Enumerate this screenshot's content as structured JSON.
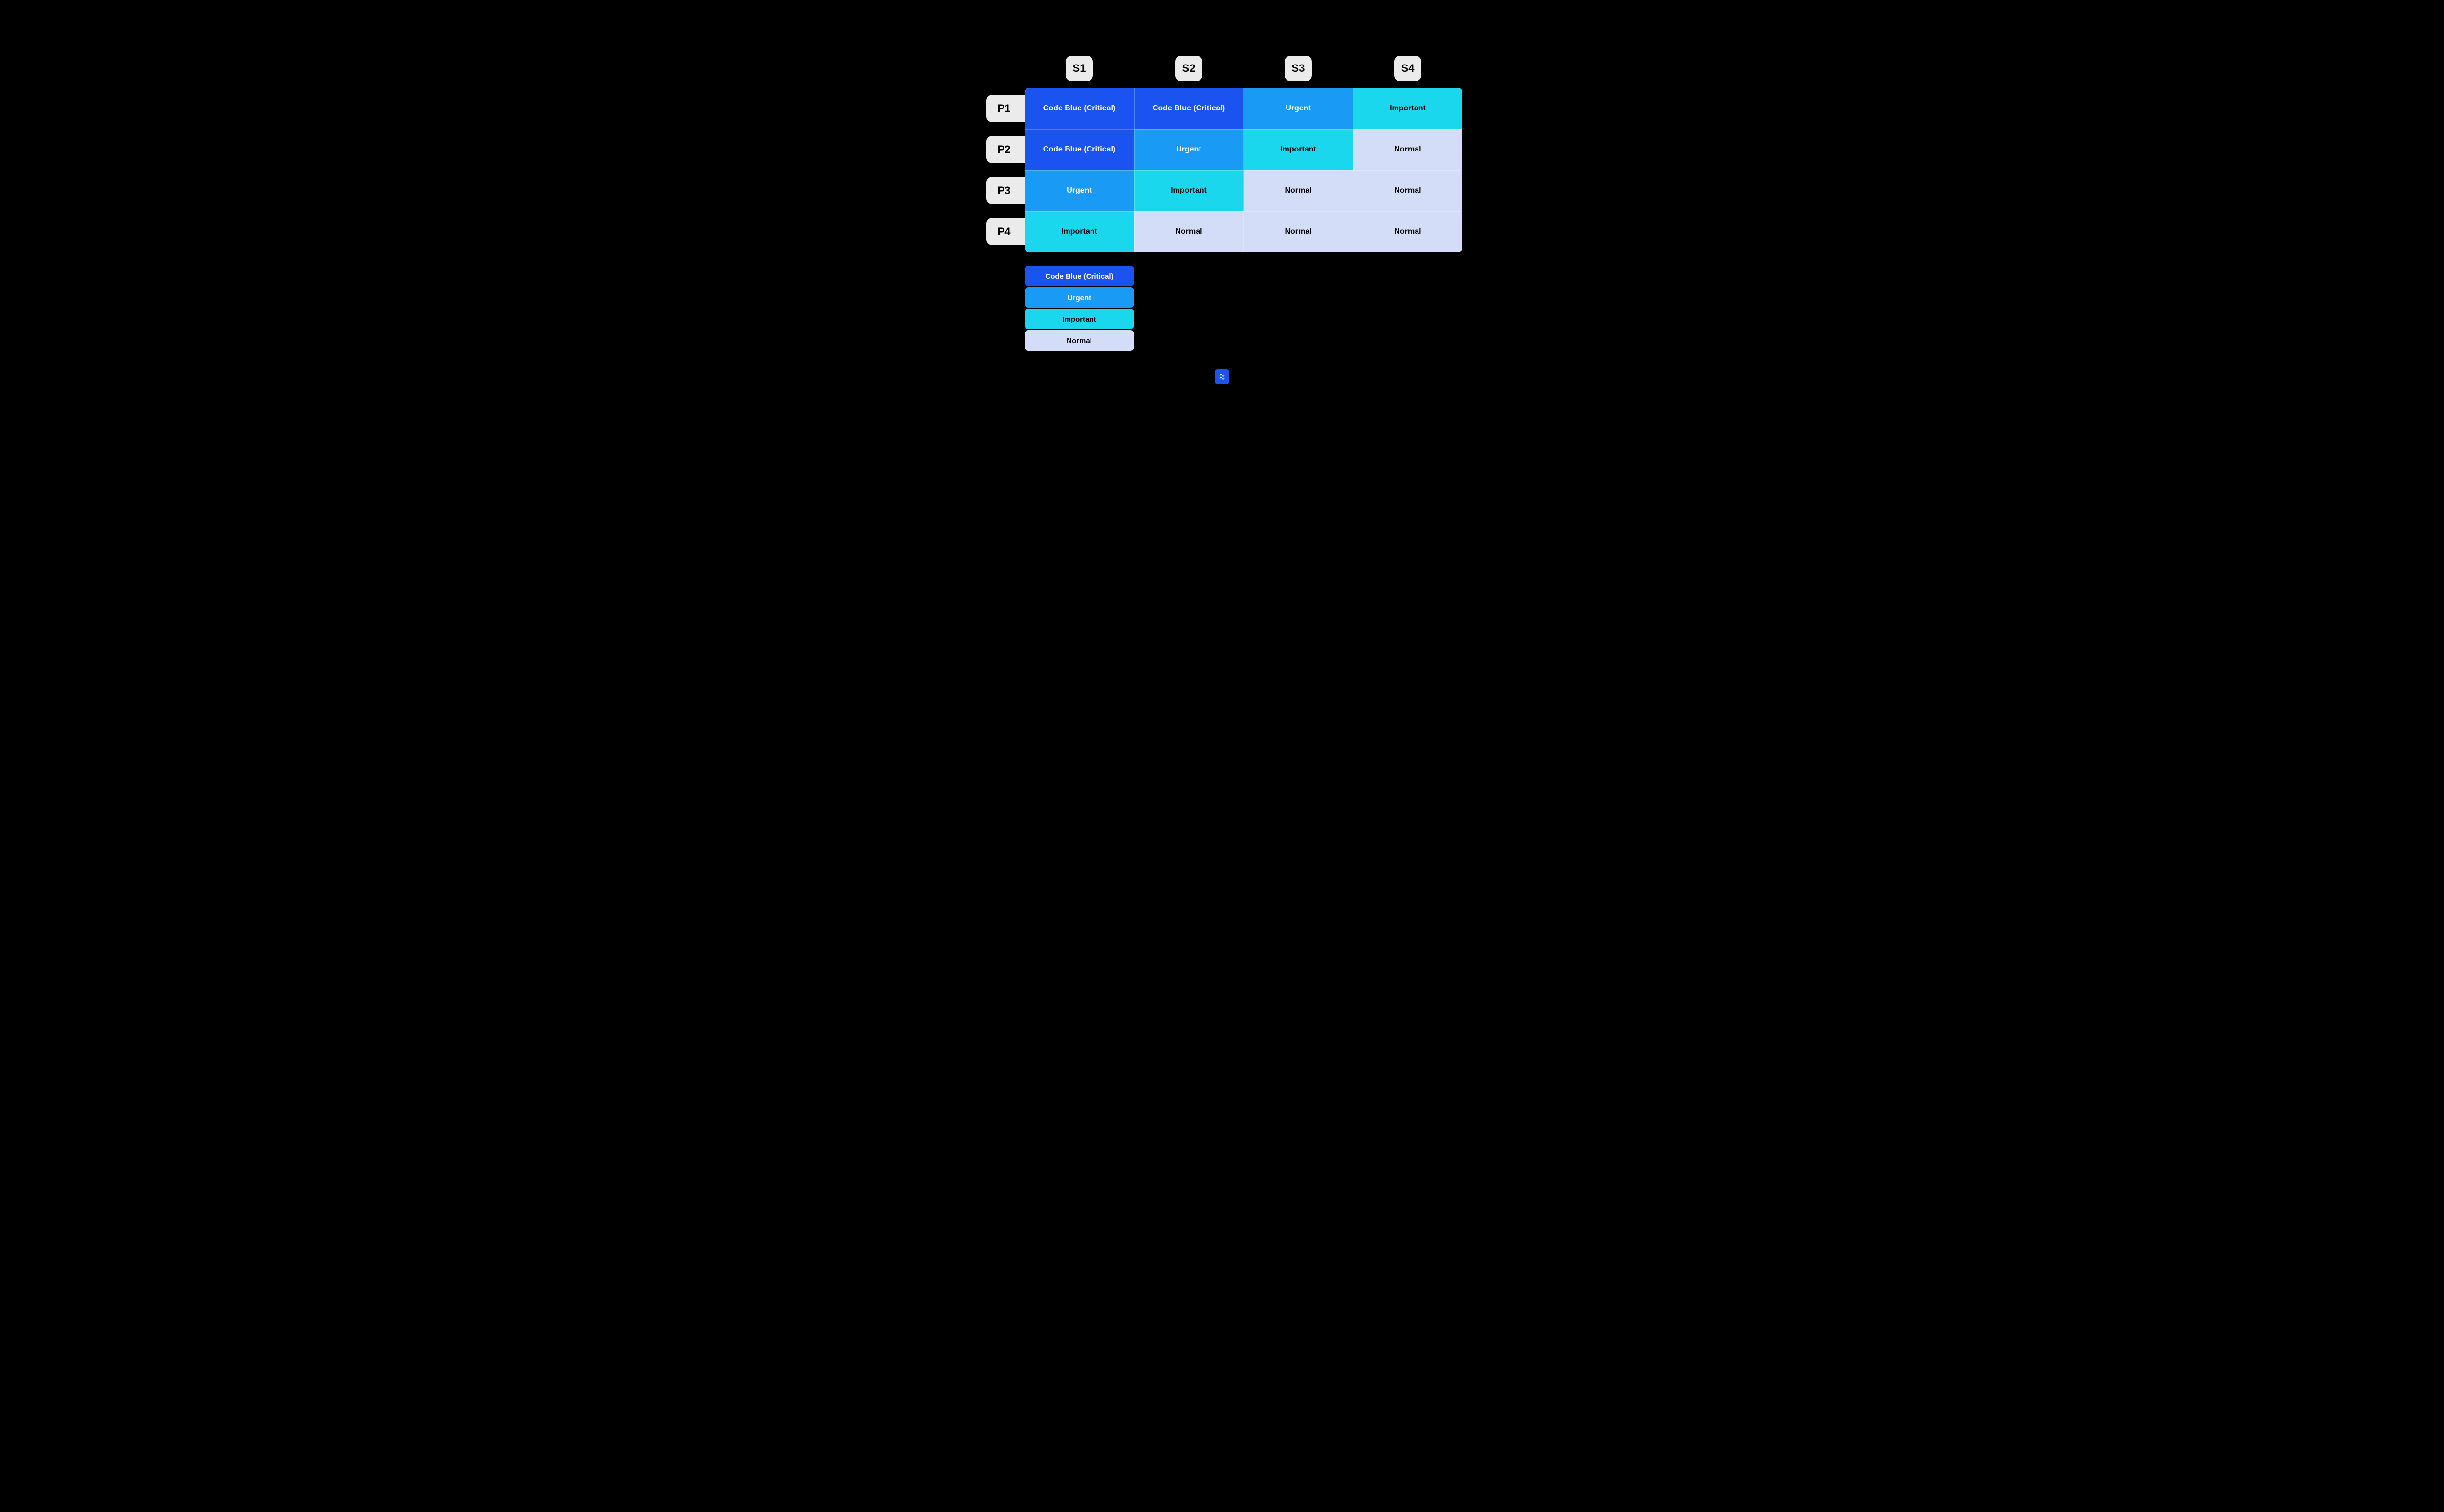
{
  "columns": [
    "S1",
    "S2",
    "S3",
    "S4"
  ],
  "rows": [
    "P1",
    "P2",
    "P3",
    "P4"
  ],
  "levels": {
    "critical": {
      "label": "Code Blue (Critical)",
      "color": "#1a53f0",
      "text": "#ffffff"
    },
    "urgent": {
      "label": "Urgent",
      "color": "#189af5",
      "text": "#ffffff"
    },
    "important": {
      "label": "Important",
      "color": "#1ad7ee",
      "text": "#000000"
    },
    "normal": {
      "label": "Normal",
      "color": "#d3ddf8",
      "text": "#000000"
    }
  },
  "matrix": [
    [
      "critical",
      "critical",
      "urgent",
      "important"
    ],
    [
      "critical",
      "urgent",
      "important",
      "normal"
    ],
    [
      "urgent",
      "important",
      "normal",
      "normal"
    ],
    [
      "important",
      "normal",
      "normal",
      "normal"
    ]
  ],
  "legend_order": [
    "critical",
    "urgent",
    "important",
    "normal"
  ],
  "footer_icon": "shortcut-logo"
}
